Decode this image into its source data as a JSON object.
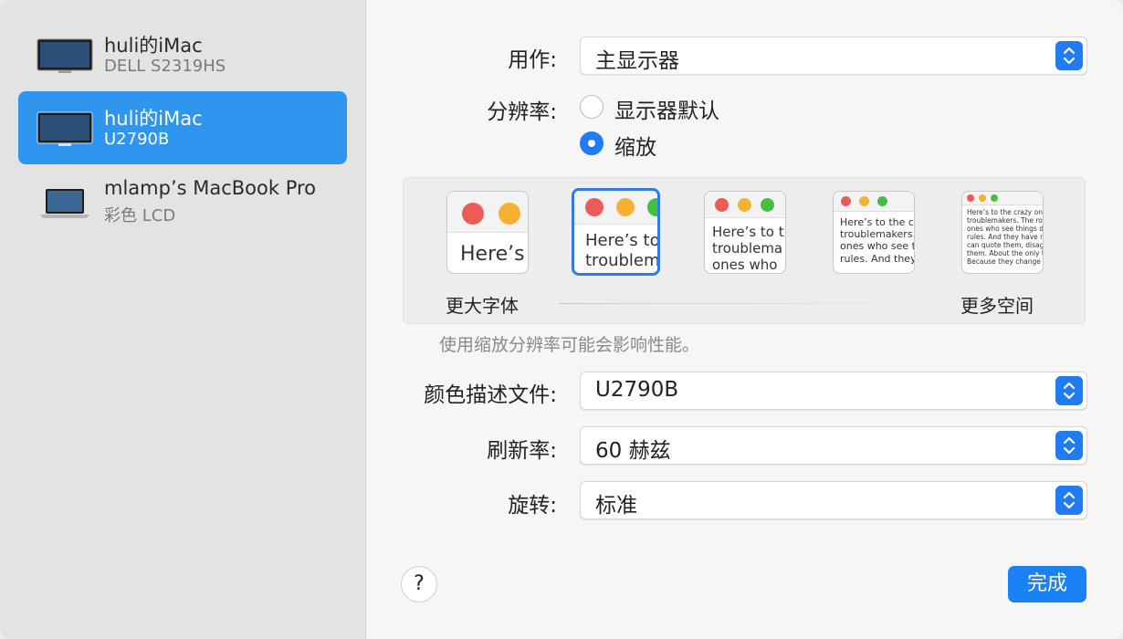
{
  "sidebar": {
    "devices": [
      {
        "name": "huli的iMac",
        "model": "DELL S2319HS",
        "icon": "monitor-icon"
      },
      {
        "name": "huli的iMac",
        "model": "U2790B",
        "icon": "monitor-icon"
      },
      {
        "name": "mlamp’s MacBook Pro",
        "model": "彩色 LCD",
        "icon": "laptop-icon"
      }
    ]
  },
  "settings": {
    "use_as_label": "用作:",
    "use_as_value": "主显示器",
    "resolution_label": "分辨率:",
    "resolution_default": "显示器默认",
    "resolution_scaled": "缩放",
    "color_profile_label": "颜色描述文件:",
    "color_profile_value": "U2790B",
    "refresh_label": "刷新率:",
    "refresh_value": "60 赫兹",
    "rotation_label": "旋转:",
    "rotation_value": "标准"
  },
  "scaling": {
    "larger_text": "更大字体",
    "more_space": "更多空间",
    "note": "使用缩放分辨率可能会影响性能。",
    "previews": [
      "Here’s",
      "Here’s to\ntroublem",
      "Here’s to t\ntroublema\nones who",
      "Here’s to the cr\ntroublemakers.\nones who see t\nrules. And they",
      "Here’s to the crazy one\ntroublemakers. The rou\nones who see things dif\nrules. And they have no\ncan quote them, disagr\nthem. About the only th\nBecause they change th"
    ]
  },
  "buttons": {
    "help": "?",
    "done": "完成"
  },
  "colors": {
    "accent": "#1f7cf3",
    "selected_row": "#2f96f0"
  }
}
